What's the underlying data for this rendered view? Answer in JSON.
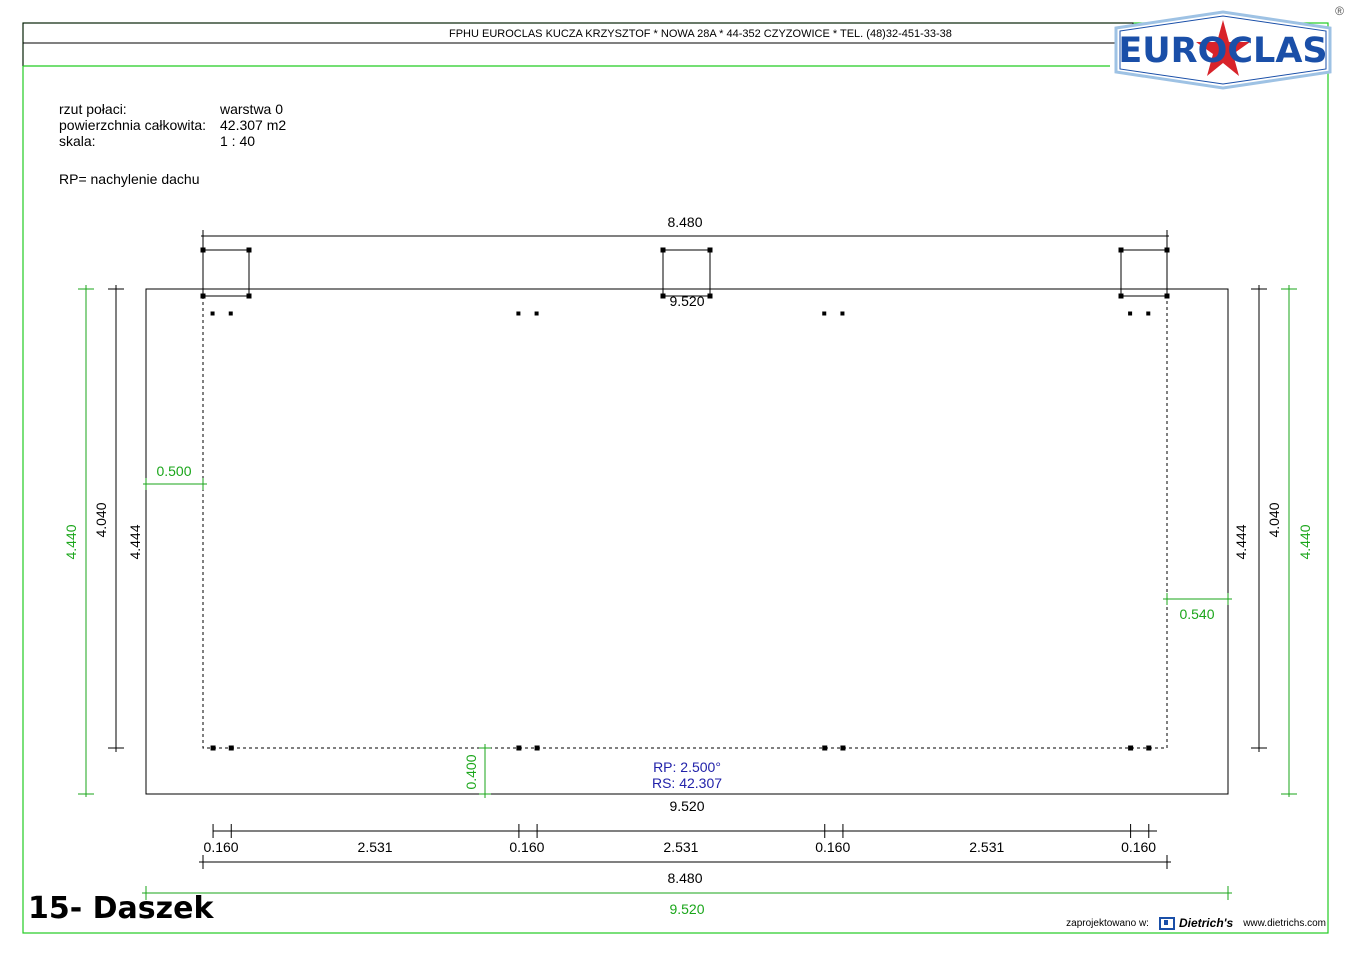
{
  "header": {
    "company_line": "FPHU EUROCLAS KUCZA KRZYSZTOF * NOWA 28A * 44-352 CZYZOWICE * TEL. (48)32-451-33-38"
  },
  "logo": {
    "text": "EUROCLAS",
    "registered_mark": "®",
    "colors": {
      "fill": "#1a4fa8",
      "star": "#d8232a",
      "border": "#9ec2e4"
    }
  },
  "info": [
    {
      "label": "rzut połaci:",
      "value": "warstwa 0"
    },
    {
      "label": "powierzchnia całkowita:",
      "value": "42.307 m2"
    },
    {
      "label": "skala:",
      "value": "1 : 40"
    }
  ],
  "note": "RP= nachylenie dachu",
  "sheet_title": "15- Daszek",
  "footer": {
    "designed_in": "zaprojektowano w:",
    "brand": "Dietrich's",
    "website": "www.dietrichs.com"
  },
  "colors": {
    "dimension_black": "#000000",
    "dimension_green": "#1aa61a",
    "label_blue": "#2222aa",
    "frame_green": "#22cc22"
  },
  "roof": {
    "width": 9.52,
    "depth": 4.444,
    "inner_width": 8.48,
    "inner_depth": 4.04,
    "overhang_left": 0.5,
    "overhang_right": 0.54,
    "overhang_front": 0.4,
    "rafter_width": 0.16,
    "rafter_spacing": 2.531,
    "labels": {
      "top_inner_width": "8.480",
      "top_full_width": "9.520",
      "bottom_full_width": "9.520",
      "bottom_inner_width": "8.480",
      "bottom_overall_width": "9.520",
      "left_outer_depth": "4.440",
      "left_inner_depth": "4.040",
      "left_depth": "4.444",
      "right_outer_depth": "4.440",
      "right_inner_depth": "4.040",
      "right_depth": "4.444",
      "left_overhang": "0.500",
      "right_overhang": "0.540",
      "front_overhang": "0.400",
      "segments": [
        "0.160",
        "2.531",
        "0.160",
        "2.531",
        "0.160",
        "2.531",
        "0.160"
      ],
      "slope": "RP: 2.500°",
      "area": "RS: 42.307"
    }
  }
}
